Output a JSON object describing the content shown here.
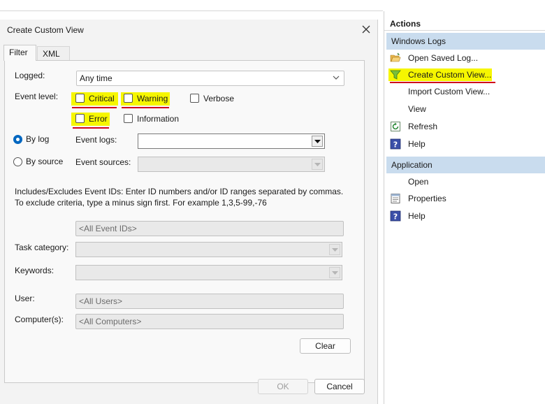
{
  "dialog": {
    "title": "Create Custom View",
    "tabs": [
      "Filter",
      "XML"
    ],
    "logged_label": "Logged:",
    "logged_value": "Any time",
    "event_level_label": "Event level:",
    "levels": {
      "critical": "Critical",
      "warning": "Warning",
      "verbose": "Verbose",
      "error": "Error",
      "information": "Information"
    },
    "by_log_label": "By log",
    "by_source_label": "By source",
    "event_logs_label": "Event logs:",
    "event_sources_label": "Event sources:",
    "ids_description": "Includes/Excludes Event IDs: Enter ID numbers and/or ID ranges separated by commas. To exclude criteria, type a minus sign first. For example 1,3,5-99,-76",
    "event_ids_placeholder": "<All Event IDs>",
    "task_category_label": "Task category:",
    "keywords_label": "Keywords:",
    "user_label": "User:",
    "user_placeholder": "<All Users>",
    "computers_label": "Computer(s):",
    "computers_placeholder": "<All Computers>",
    "clear_label": "Clear",
    "ok_label": "OK",
    "cancel_label": "Cancel"
  },
  "actions": {
    "header": "Actions",
    "sections": [
      {
        "title": "Windows Logs",
        "items": [
          {
            "label": "Open Saved Log...",
            "icon": "folder-open-icon"
          },
          {
            "label": "Create Custom View...",
            "icon": "filter-icon"
          },
          {
            "label": "Import Custom View...",
            "icon": ""
          },
          {
            "label": "View",
            "icon": ""
          },
          {
            "label": "Refresh",
            "icon": "refresh-icon"
          },
          {
            "label": "Help",
            "icon": "help-icon"
          }
        ]
      },
      {
        "title": "Application",
        "items": [
          {
            "label": "Open",
            "icon": ""
          },
          {
            "label": "Properties",
            "icon": "properties-icon"
          },
          {
            "label": "Help",
            "icon": "help-icon"
          }
        ]
      }
    ]
  },
  "colors": {
    "highlight": "#f6f600",
    "underline": "#d0021b",
    "section_bg": "#c9dcee",
    "radio_selected": "#0067c0"
  }
}
